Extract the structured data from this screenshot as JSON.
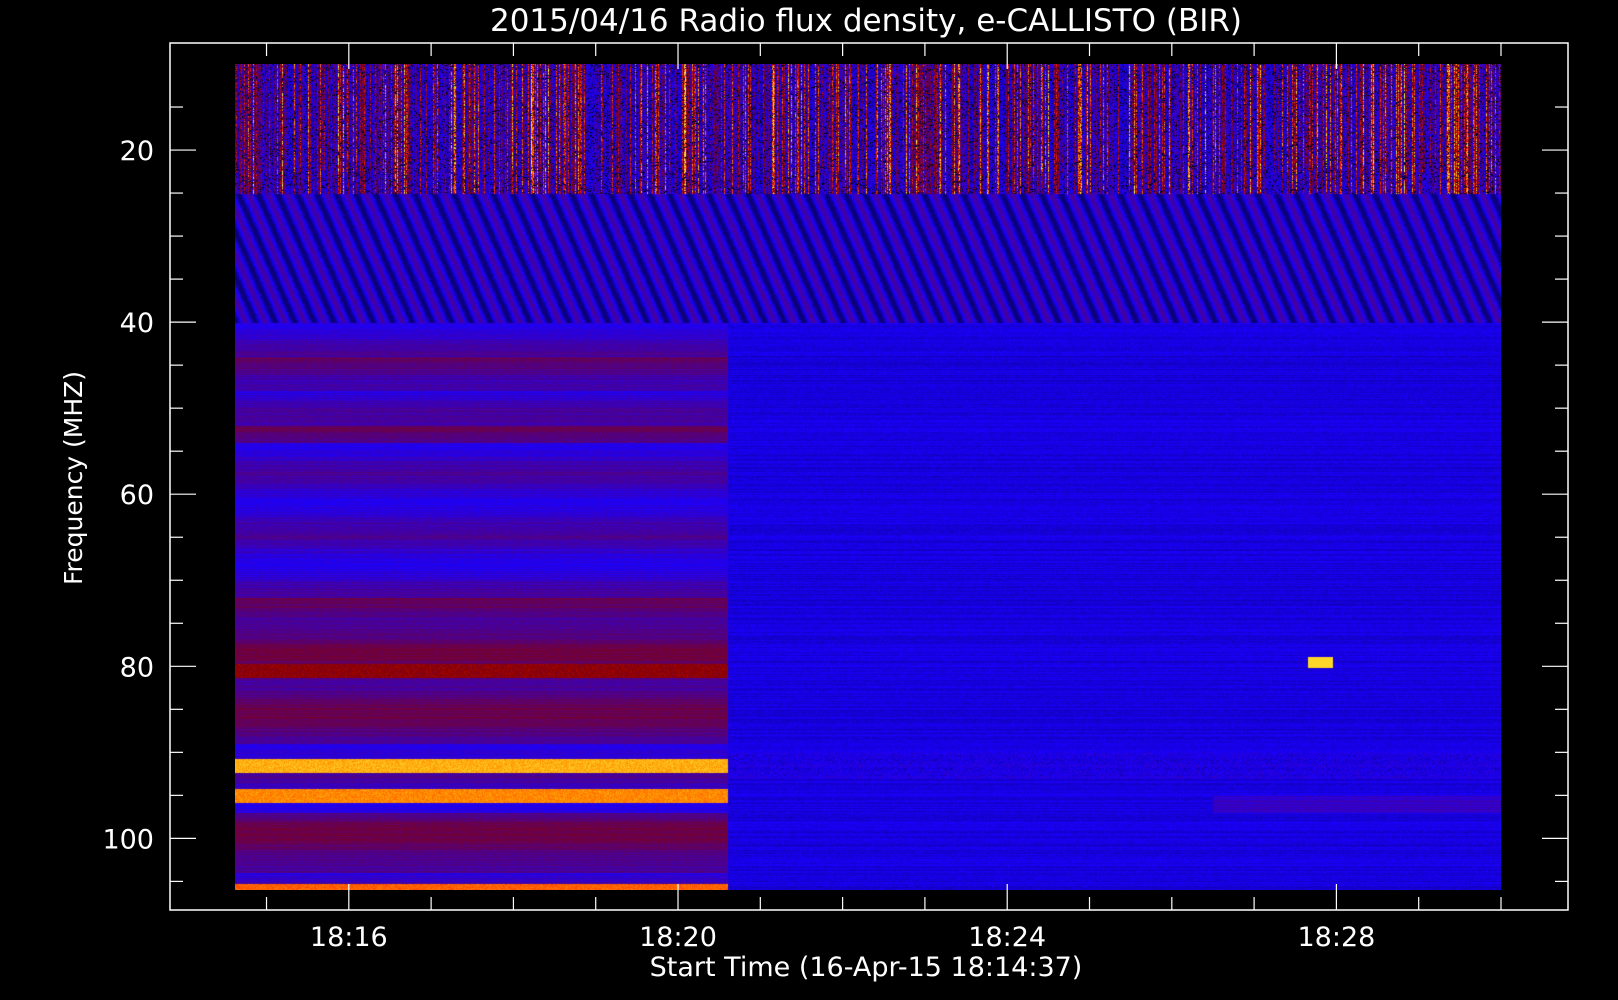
{
  "chart_data": {
    "type": "heatmap",
    "title": "2015/04/16  Radio flux density, e-CALLISTO (BIR)",
    "xlabel": "Start Time (16-Apr-15 18:14:37)",
    "ylabel": "Frequency (MHZ)",
    "x_tick_labels": [
      "18:16",
      "18:20",
      "18:24",
      "18:28"
    ],
    "y_tick_labels": [
      "20",
      "40",
      "60",
      "80",
      "100"
    ],
    "x_tick_values_min": [
      16,
      20,
      24,
      28
    ],
    "y_tick_values": [
      20,
      40,
      60,
      80,
      100
    ],
    "xlim_min": [
      14.617,
      30.0
    ],
    "ylim_mhz": [
      10,
      106
    ],
    "y_reversed": true,
    "colormap": [
      "#000000",
      "#1a00ff",
      "#8b0000",
      "#ff2000",
      "#ff9000",
      "#ffff40"
    ],
    "features": [
      {
        "desc": "persistent bright band",
        "freq_mhz": 91.5,
        "t_end_min": 20.6,
        "level": 0.9
      },
      {
        "desc": "persistent bright band",
        "freq_mhz": 95.0,
        "t_end_min": 20.6,
        "level": 0.85
      },
      {
        "desc": "bright band at bottom edge",
        "freq_mhz": 106.0,
        "t_end_min": 20.6,
        "level": 0.8
      },
      {
        "desc": "moderate band",
        "freq_mhz": 80.5,
        "t_end_min": 20.6,
        "level": 0.55
      },
      {
        "desc": "short bright spot",
        "freq_mhz": 79.5,
        "t_min": 27.8,
        "level": 0.95
      }
    ]
  },
  "colors": {
    "background": "#000000",
    "frame": "#ffffff",
    "low": "#1a00ff",
    "high": "#ffcc00"
  }
}
